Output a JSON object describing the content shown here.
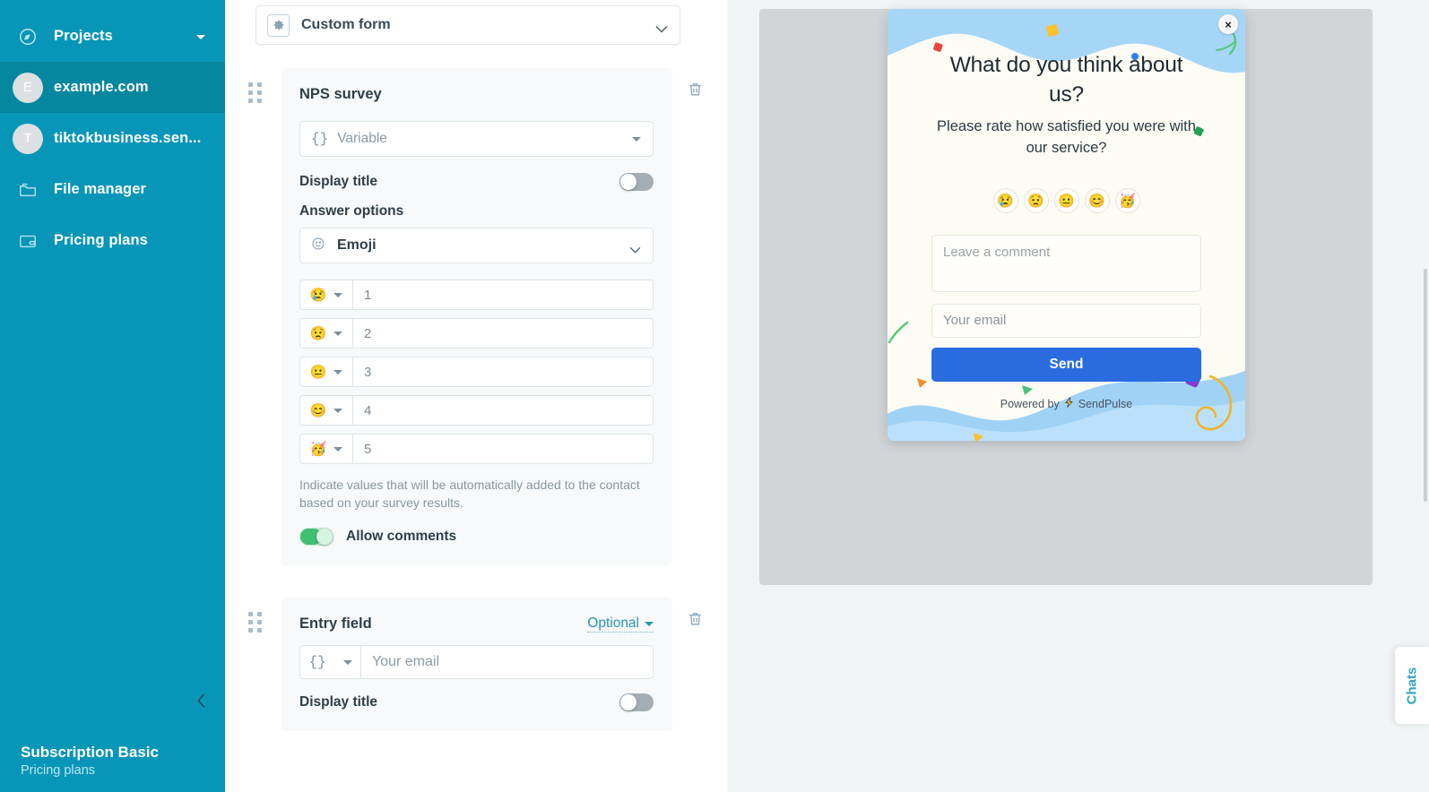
{
  "sidebar": {
    "header": {
      "label": "Projects",
      "icon": "compass-icon",
      "caret": "chevron-down-icon"
    },
    "items": [
      {
        "label": "example.com",
        "avatar": "E",
        "active": true,
        "icon": "project-avatar"
      },
      {
        "label": "tiktokbusiness.sen...",
        "avatar": "T",
        "active": false,
        "icon": "project-avatar"
      },
      {
        "label": "File manager",
        "avatar": "",
        "active": false,
        "icon": "folder-icon"
      },
      {
        "label": "Pricing plans",
        "avatar": "",
        "active": false,
        "icon": "wallet-icon"
      }
    ],
    "footer": {
      "plan": "Subscription Basic",
      "link": "Pricing plans"
    },
    "collapse_icon": "chevron-left-icon",
    "bg_color": "#0796B8",
    "active_color": "#04879F"
  },
  "editor": {
    "form_type": {
      "label": "Custom form",
      "icon": "gear-icon",
      "caret": "chevron-down-icon"
    },
    "blocks": [
      {
        "title": "NPS survey",
        "variable": {
          "placeholder": "Variable",
          "icon": "braces-icon"
        },
        "display_title": {
          "label": "Display title",
          "state": "off"
        },
        "answer_options": {
          "label": "Answer options",
          "type": {
            "label": "Emoji",
            "icon": "smiley-icon"
          },
          "rows": [
            {
              "emoji": "😢",
              "value": "1"
            },
            {
              "emoji": "😟",
              "value": "2"
            },
            {
              "emoji": "😐",
              "value": "3"
            },
            {
              "emoji": "😊",
              "value": "4"
            },
            {
              "emoji": "🥳",
              "value": "5"
            }
          ]
        },
        "hint": "Indicate values that will be automatically added to the contact based on your survey results.",
        "allow_comments": {
          "label": "Allow comments",
          "state": "on"
        },
        "delete_icon": "trash-icon",
        "drag_icon": "drag-handle-icon"
      },
      {
        "title": "Entry field",
        "optional": {
          "label": "Optional",
          "caret": "chevron-down-icon"
        },
        "field": {
          "icon": "braces-icon",
          "placeholder": "Your email"
        },
        "display_title": {
          "label": "Display title",
          "state": "off"
        },
        "delete_icon": "trash-icon",
        "drag_icon": "drag-handle-icon"
      }
    ]
  },
  "preview": {
    "canvas_bg": "#D1D5D8",
    "popup": {
      "close_label": "×",
      "title": "What do you think about us?",
      "subtitle": "Please rate how satisfied you were with our service?",
      "emojis": [
        "😢",
        "😟",
        "😐",
        "😊",
        "🥳"
      ],
      "comment_placeholder": "Leave a comment",
      "email_placeholder": "Your email",
      "send_label": "Send",
      "powered_prefix": "Powered by",
      "powered_brand": "SendPulse",
      "powered_icon": "bolt-icon",
      "accent_color": "#2A6CE0",
      "wave_color": "#A6D6F7",
      "body_color": "#FDFCF4"
    }
  },
  "chats_tab": {
    "label": "Chats",
    "color": "#34A3BE"
  }
}
